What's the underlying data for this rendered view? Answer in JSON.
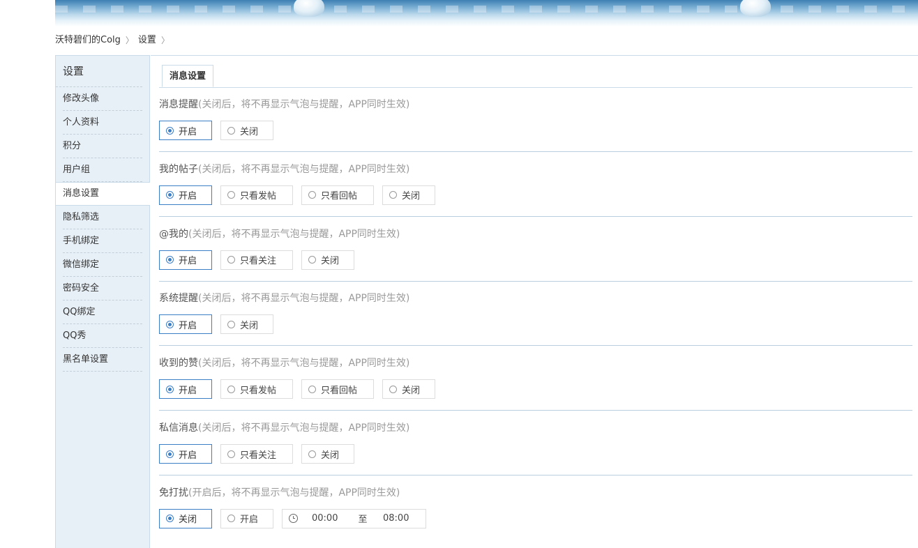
{
  "breadcrumb": {
    "home": "沃特碧们的Colg",
    "current": "设置"
  },
  "sidebar": {
    "title": "设置",
    "items": [
      {
        "label": "修改头像"
      },
      {
        "label": "个人资料"
      },
      {
        "label": "积分"
      },
      {
        "label": "用户组"
      },
      {
        "label": "消息设置",
        "active": true
      },
      {
        "label": "隐私筛选"
      },
      {
        "label": "手机绑定"
      },
      {
        "label": "微信绑定"
      },
      {
        "label": "密码安全"
      },
      {
        "label": "QQ绑定"
      },
      {
        "label": "QQ秀"
      },
      {
        "label": "黑名单设置"
      }
    ]
  },
  "tab": {
    "label": "消息设置"
  },
  "sections": [
    {
      "title": "消息提醒",
      "desc": "(关闭后，将不再显示气泡与提醒，APP同时生效)",
      "options": [
        "开启",
        "关闭"
      ],
      "selected": "开启"
    },
    {
      "title": "我的帖子",
      "desc": "(关闭后，将不再显示气泡与提醒，APP同时生效)",
      "options": [
        "开启",
        "只看发帖",
        "只看回帖",
        "关闭"
      ],
      "selected": "开启"
    },
    {
      "title": "@我的",
      "desc": "(关闭后，将不再显示气泡与提醒，APP同时生效)",
      "options": [
        "开启",
        "只看关注",
        "关闭"
      ],
      "selected": "开启"
    },
    {
      "title": "系统提醒",
      "desc": "(关闭后，将不再显示气泡与提醒，APP同时生效)",
      "options": [
        "开启",
        "关闭"
      ],
      "selected": "开启"
    },
    {
      "title": "收到的赞",
      "desc": "(关闭后，将不再显示气泡与提醒，APP同时生效)",
      "options": [
        "开启",
        "只看发帖",
        "只看回帖",
        "关闭"
      ],
      "selected": "开启"
    },
    {
      "title": "私信消息",
      "desc": "(关闭后，将不再显示气泡与提醒，APP同时生效)",
      "options": [
        "开启",
        "只看关注",
        "关闭"
      ],
      "selected": "开启"
    },
    {
      "title": "免打扰",
      "desc": "(开启后，将不再显示气泡与提醒，APP同时生效)",
      "options": [
        "关闭",
        "开启"
      ],
      "selected": "关闭"
    }
  ],
  "dnd_time": {
    "start": "00:00",
    "to_label": "至",
    "end": "08:00"
  },
  "colors": {
    "accent": "#3a7ec6",
    "sidebar_bg": "#e8f0f7",
    "border": "#c9dbe8"
  }
}
